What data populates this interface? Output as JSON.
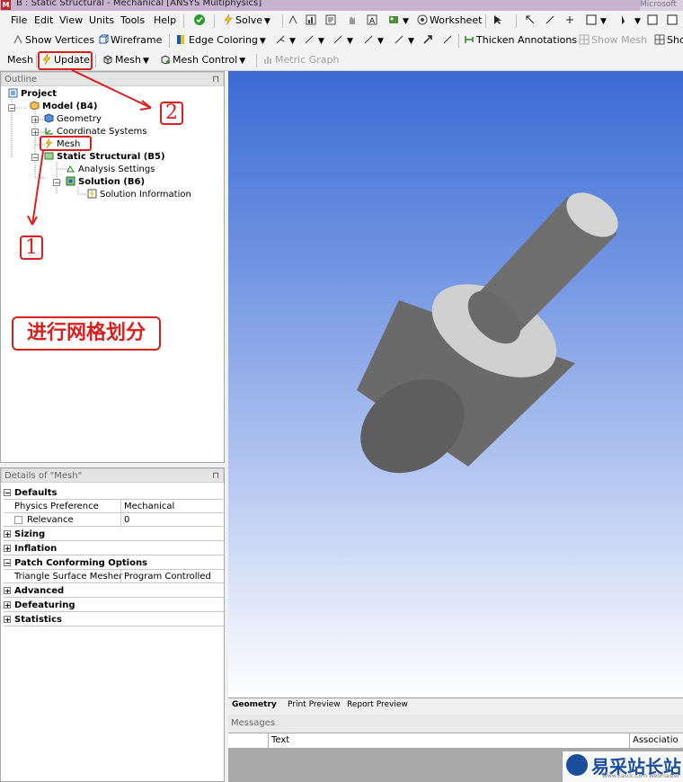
{
  "window": {
    "title": "B : Static Structural - Mechanical [ANSYS Multiphysics]",
    "title_right": "Microsoft"
  },
  "menu": [
    "File",
    "Edit",
    "View",
    "Units",
    "Tools",
    "Help"
  ],
  "toolbar1": {
    "solve": "Solve",
    "worksheet": "Worksheet"
  },
  "toolbar2": {
    "show_vertices": "Show Vertices",
    "wireframe": "Wireframe",
    "edge_coloring": "Edge Coloring",
    "thicken_annotations": "Thicken Annotations",
    "show_mesh": "Show Mesh",
    "show_cut": "Sho"
  },
  "toolbar3": {
    "mesh": "Mesh",
    "update": "Update",
    "mesh_menu": "Mesh",
    "mesh_control": "Mesh Control",
    "metric_graph": "Metric Graph"
  },
  "outline": {
    "title": "Outline",
    "pin": "ᵖ",
    "items": [
      "Project",
      "Model (B4)",
      "Geometry",
      "Coordinate Systems",
      "Mesh",
      "Static Structural (B5)",
      "Analysis Settings",
      "Solution (B6)",
      "Solution Information"
    ]
  },
  "details": {
    "title": "Details of \"Mesh\"",
    "pin": "ᵖ",
    "rows": [
      {
        "group": "Defaults"
      },
      {
        "key": "Physics Preference",
        "value": "Mechanical"
      },
      {
        "key": "Relevance",
        "value": "0"
      },
      {
        "group": "Sizing"
      },
      {
        "group": "Inflation"
      },
      {
        "group": "Patch Conforming Options"
      },
      {
        "key": "Triangle Surface Mesher",
        "value": "Program Controlled"
      },
      {
        "group": "Advanced"
      },
      {
        "group": "Defeaturing"
      },
      {
        "group": "Statistics"
      }
    ]
  },
  "view_tabs": [
    "Geometry",
    "Print Preview",
    "Report Preview"
  ],
  "messages": {
    "title": "Messages",
    "col_text": "Text",
    "col_assoc": "Associatio"
  },
  "annotations": {
    "num1": "1",
    "num2": "2",
    "note": "进行网格划分"
  },
  "watermark": {
    "text": "易采站长站",
    "sub": "Www.Easck.Com Webmaster"
  },
  "colors": {
    "accent_red": "#d92020",
    "viewport_top": "#3b6bd3",
    "part_gray": "#6a6a6a"
  }
}
